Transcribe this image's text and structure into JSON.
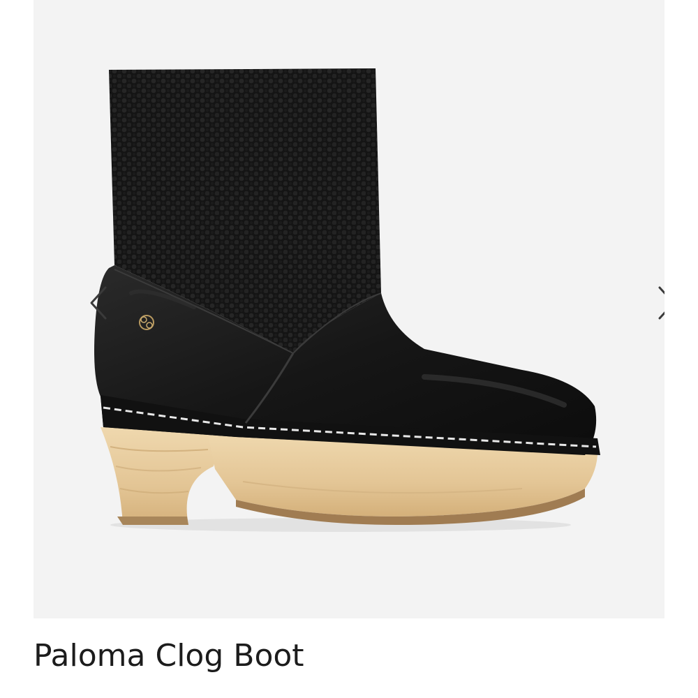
{
  "product": {
    "title": "Paloma Clog Boot"
  },
  "gallery": {
    "prev_icon": "chevron-left-icon",
    "next_icon": "chevron-right-icon",
    "image_subject": "boot-image"
  },
  "colors": {
    "gallery_background": "#f3f3f3",
    "title_text": "#1c1c1c",
    "arrow": "#3a3a3a"
  }
}
